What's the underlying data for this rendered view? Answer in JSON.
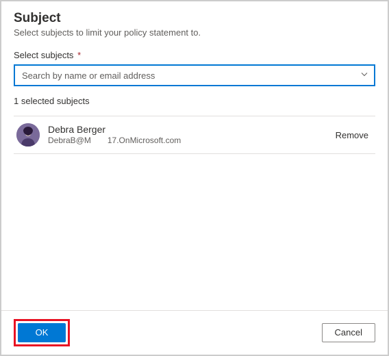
{
  "header": {
    "title": "Subject",
    "subtitle": "Select subjects to limit your policy statement to."
  },
  "field": {
    "label": "Select subjects",
    "required": "*",
    "placeholder": "Search by name or email address"
  },
  "selected": {
    "count_text": "1 selected subjects"
  },
  "rows": [
    {
      "name": "Debra Berger",
      "email_part1": "DebraB@M",
      "email_part2": "17.OnMicrosoft.com",
      "remove_label": "Remove"
    }
  ],
  "footer": {
    "ok_label": "OK",
    "cancel_label": "Cancel"
  }
}
